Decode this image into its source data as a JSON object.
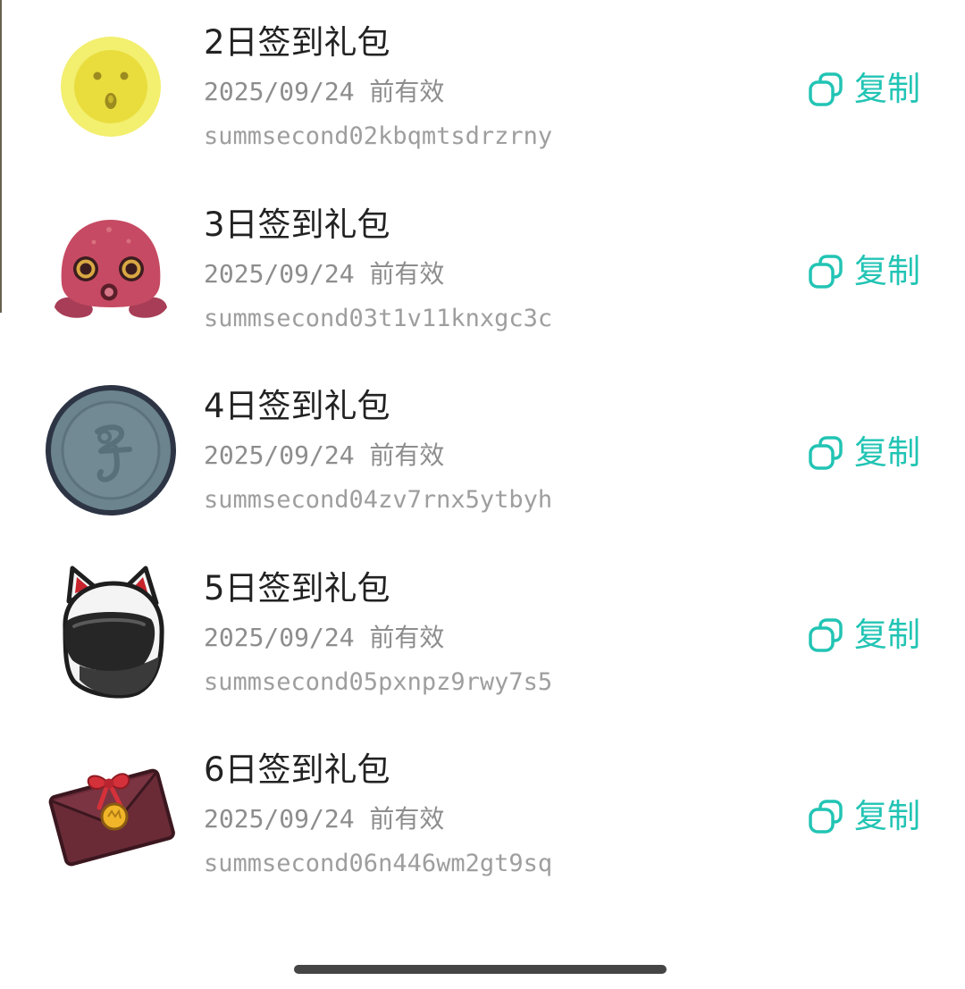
{
  "colors": {
    "accent": "#22c4b4",
    "title": "#222222",
    "secondary": "#8d8d8d",
    "code": "#9e9e9e",
    "background": "#ffffff",
    "home_indicator": "#454545",
    "edge_line": "#66634f"
  },
  "items": [
    {
      "icon": "yellow-coin-face-icon",
      "title": "2日签到礼包",
      "expiry": "2025/09/24 前有效",
      "code": "summsecond02kbqmtsdrzrny",
      "copy_icon": "copy-icon",
      "copy_label": "复制"
    },
    {
      "icon": "pink-octopus-icon",
      "title": "3日签到礼包",
      "expiry": "2025/09/24 前有效",
      "code": "summsecond03t1v11knxgc3c",
      "copy_icon": "copy-icon",
      "copy_label": "复制"
    },
    {
      "icon": "slate-coin-icon",
      "title": "4日签到礼包",
      "expiry": "2025/09/24 前有效",
      "code": "summsecond04zv7rnx5ytbyh",
      "copy_icon": "copy-icon",
      "copy_label": "复制"
    },
    {
      "icon": "cat-helmet-icon",
      "title": "5日签到礼包",
      "expiry": "2025/09/24 前有效",
      "code": "summsecond05pxnpz9rwy7s5",
      "copy_icon": "copy-icon",
      "copy_label": "复制"
    },
    {
      "icon": "gift-envelope-icon",
      "title": "6日签到礼包",
      "expiry": "2025/09/24 前有效",
      "code": "summsecond06n446wm2gt9sq",
      "copy_icon": "copy-icon",
      "copy_label": "复制"
    }
  ]
}
